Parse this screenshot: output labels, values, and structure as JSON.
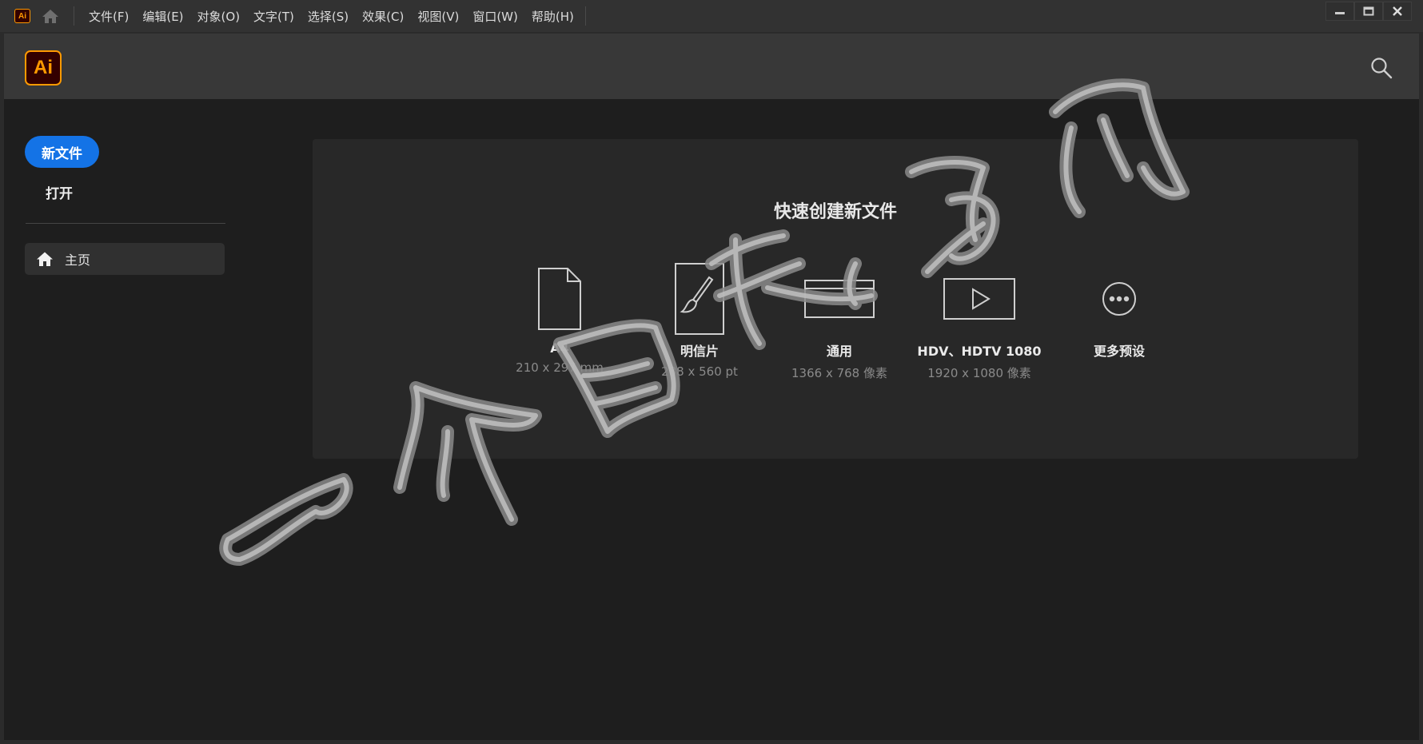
{
  "app": {
    "badge": "Ai",
    "logo": "Ai",
    "brand_color": "#ff9a00",
    "accent_color": "#1473e6"
  },
  "menu": {
    "items": [
      "文件(F)",
      "编辑(E)",
      "对象(O)",
      "文字(T)",
      "选择(S)",
      "效果(C)",
      "视图(V)",
      "窗口(W)",
      "帮助(H)"
    ]
  },
  "window_controls": {
    "minimize_icon": "minimize-icon",
    "maximize_icon": "maximize-icon",
    "close_icon": "close-icon"
  },
  "sidebar": {
    "new_file": "新文件",
    "open": "打开",
    "nav": [
      {
        "label": "主页",
        "icon": "home-icon"
      }
    ]
  },
  "quick_create": {
    "title": "快速创建新文件",
    "presets": [
      {
        "name": "A4",
        "size": "210 x 297 mm",
        "icon": "document-icon"
      },
      {
        "name": "明信片",
        "size": "288 x 560 pt",
        "icon": "brush-icon"
      },
      {
        "name": "通用",
        "size": "1366 x 768 像素",
        "icon": "screen-icon"
      },
      {
        "name": "HDV、HDTV 1080",
        "size": "1920 x 1080 像素",
        "icon": "video-icon"
      },
      {
        "name": "更多预设",
        "size": "",
        "icon": "more-icon"
      }
    ]
  },
  "watermark": {
    "text": "一个自乐为用"
  }
}
